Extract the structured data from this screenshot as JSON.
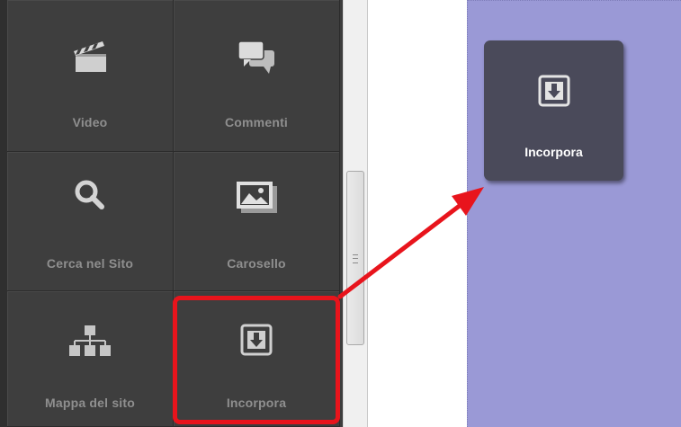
{
  "widgets": [
    {
      "label": "Video",
      "icon": "clapperboard-icon"
    },
    {
      "label": "Commenti",
      "icon": "speech-bubbles-icon"
    },
    {
      "label": "Cerca nel Sito",
      "icon": "magnifier-icon"
    },
    {
      "label": "Carosello",
      "icon": "image-carousel-icon"
    },
    {
      "label": "Mappa del sito",
      "icon": "sitemap-icon"
    },
    {
      "label": "Incorpora",
      "icon": "embed-icon"
    }
  ],
  "canvas": {
    "dropped_widget": {
      "label": "Incorpora",
      "icon": "embed-icon"
    }
  },
  "colors": {
    "panel_bg": "#3e3e3e",
    "tile_label": "#8f8f8f",
    "canvas_bg": "#9a99d6",
    "highlight": "#e8141c",
    "dropped_bg": "#4a4a5a"
  }
}
